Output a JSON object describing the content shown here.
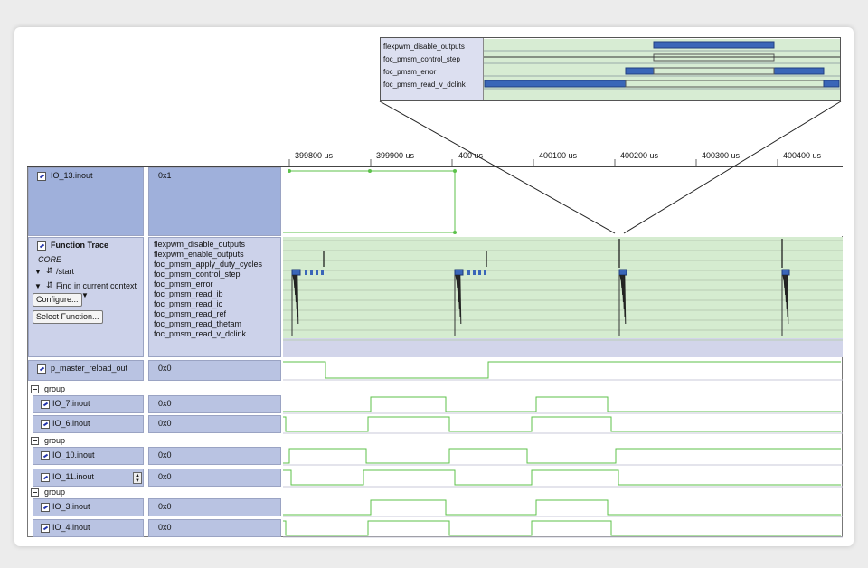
{
  "time_ruler": {
    "ticks": [
      "399800 us",
      "399900 us",
      "400 us",
      "400100 us",
      "400200 us",
      "400300 us",
      "400400 us"
    ]
  },
  "zoom_inset": {
    "labels": [
      "flexpwm_disable_outputs",
      "foc_pmsm_control_step",
      "foc_pmsm_error",
      "foc_pmsm_read_v_dclink"
    ]
  },
  "signals": {
    "io13": {
      "name": "IO_13.inout",
      "value": "0x1"
    },
    "p_master": {
      "name": "p_master_reload_out",
      "value": "0x0"
    }
  },
  "function_trace": {
    "title": "Function Trace",
    "core": "CORE",
    "start": "/start",
    "find": "Find in current context",
    "configure": "Configure...",
    "select_function": "Select Function...",
    "functions": [
      "flexpwm_disable_outputs",
      "flexpwm_enable_outputs",
      "foc_pmsm_apply_duty_cycles",
      "foc_pmsm_control_step",
      "foc_pmsm_error",
      "foc_pmsm_read_ib",
      "foc_pmsm_read_ic",
      "foc_pmsm_read_ref",
      "foc_pmsm_read_thetam",
      "foc_pmsm_read_v_dclink"
    ]
  },
  "groups": [
    {
      "label": "group",
      "rows": [
        {
          "name": "IO_7.inout",
          "value": "0x0"
        },
        {
          "name": "IO_6.inout",
          "value": "0x0"
        }
      ]
    },
    {
      "label": "group",
      "rows": [
        {
          "name": "IO_10.inout",
          "value": "0x0"
        },
        {
          "name": "IO_11.inout",
          "value": "0x0"
        }
      ]
    },
    {
      "label": "group",
      "rows": [
        {
          "name": "IO_3.inout",
          "value": "0x0"
        },
        {
          "name": "IO_4.inout",
          "value": "0x0"
        }
      ]
    }
  ],
  "colors": {
    "trace_bg": "#d5ecd0",
    "cell_bg": "#b9c3e2",
    "signal": "#5cc24a",
    "bar": "#3a66b8"
  }
}
